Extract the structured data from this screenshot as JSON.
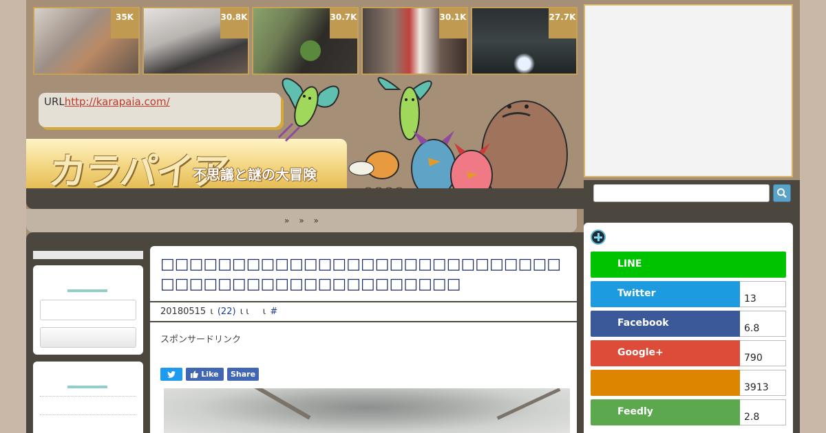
{
  "thumbs": [
    {
      "count": "35K"
    },
    {
      "count": "30.8K"
    },
    {
      "count": "30.7K"
    },
    {
      "count": "30.1K"
    },
    {
      "count": "27.7K"
    }
  ],
  "header": {
    "url_prefix": "URL",
    "url_link": "http://karapaia.com/",
    "logo_text": "カラパイア",
    "logo_subtitle": "不思議と謎の大冒険"
  },
  "nav": {
    "items": [
      "»",
      "»",
      "»"
    ]
  },
  "article": {
    "title": "□□□□□□□□□□□□□□□□□□□□□□□□□□□□□□□□□□□□□□□□□□□□□□□□□",
    "meta_date": "20180515",
    "meta_sep1": "ι",
    "meta_comments": "(22)",
    "meta_sep2": "ι ι",
    "meta_sep3": "ι",
    "meta_hash": "#",
    "sponsor": "スポンサードリンク",
    "share_like": "Like",
    "share_share": "Share"
  },
  "social": [
    {
      "label": "LINE",
      "count": "",
      "color": "#00c300"
    },
    {
      "label": "Twitter",
      "count": "13",
      "color": "#1d9be0"
    },
    {
      "label": "Facebook",
      "count": "6.8",
      "color": "#3b5998"
    },
    {
      "label": "Google+",
      "count": "790",
      "color": "#dd4b39"
    },
    {
      "label": "",
      "count": "3913",
      "color": "#dd8500"
    },
    {
      "label": "Feedly",
      "count": "2.8",
      "color": "#5ca84e"
    }
  ]
}
